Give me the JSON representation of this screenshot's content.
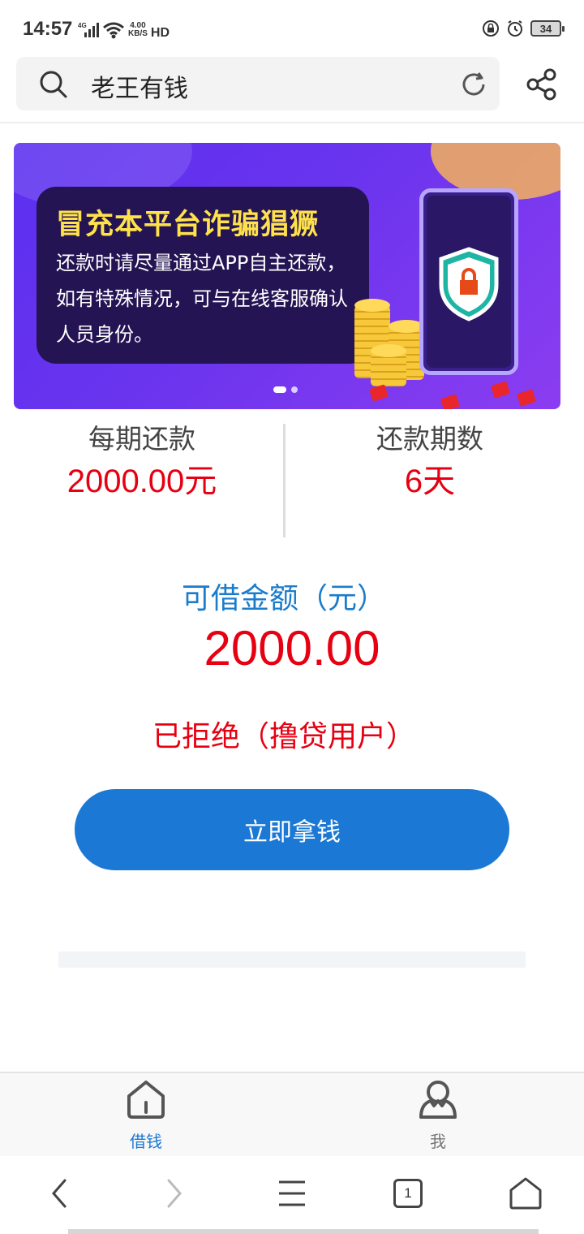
{
  "status_bar": {
    "time": "14:57",
    "network": "4G",
    "speed_value": "4.00",
    "speed_unit": "KB/S",
    "hd": "HD",
    "battery": "34"
  },
  "search": {
    "query": "老王有钱",
    "search_icon": "search-icon",
    "refresh_icon": "refresh-icon",
    "share_icon": "share-icon"
  },
  "banner": {
    "title": "冒充本平台诈骗猖獗",
    "body": "还款时请尽量通过APP自主还款，如有特殊情况，可与在线客服确认人员身份。",
    "colors": {
      "background": "#5b2ff0",
      "title": "#ffe24a",
      "card": "#241453"
    }
  },
  "loan": {
    "per_period_label": "每期还款",
    "per_period_value": "2000.00元",
    "periods_label": "还款期数",
    "periods_value": "6天",
    "amount_label": "可借金额（元）",
    "amount_value": "2000.00",
    "status": "已拒绝（撸贷用户）",
    "cta_label": "立即拿钱"
  },
  "tab_bar": {
    "items": [
      {
        "label": "借钱",
        "icon": "home-icon",
        "active": true
      },
      {
        "label": "我",
        "icon": "user-icon",
        "active": false
      }
    ]
  },
  "system_nav": {
    "tab_count": "1"
  },
  "colors": {
    "accent_blue": "#1b78d4",
    "highlight_red": "#e60012",
    "label_blue": "#1b7ccb"
  }
}
